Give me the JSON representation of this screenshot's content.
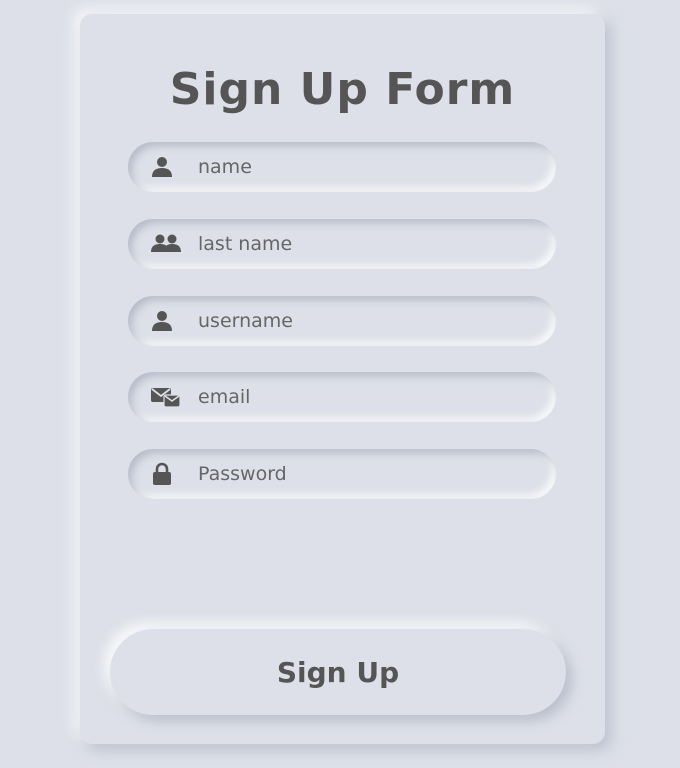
{
  "form": {
    "title": "Sign Up Form",
    "fields": [
      {
        "icon": "user-icon",
        "placeholder": "name",
        "value": ""
      },
      {
        "icon": "users-icon",
        "placeholder": "last name",
        "value": ""
      },
      {
        "icon": "user-icon",
        "placeholder": "username",
        "value": ""
      },
      {
        "icon": "mail-icon",
        "placeholder": "email",
        "value": ""
      },
      {
        "icon": "lock-icon",
        "placeholder": "Password",
        "value": ""
      }
    ],
    "submit_label": "Sign Up"
  },
  "colors": {
    "background": "#dde0e8",
    "text": "#555555",
    "icon": "#555555"
  }
}
